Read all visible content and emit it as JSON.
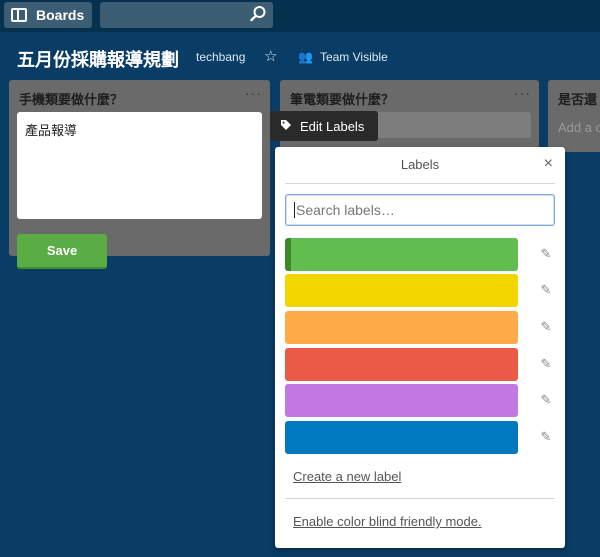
{
  "header": {
    "boards_label": "Boards",
    "search_placeholder": ""
  },
  "board": {
    "title": "五月份採購報導規劃",
    "team": "techbang",
    "visibility": "Team Visible"
  },
  "lists": [
    {
      "title": "手機類要做什麼？",
      "menu": "···",
      "card_text": "產品報導",
      "save_label": "Save"
    },
    {
      "title": "筆電類要做什麼？",
      "menu": "···"
    },
    {
      "title": "是否還",
      "add_card": "Add a c"
    }
  ],
  "tooltip": {
    "label": "Edit Labels"
  },
  "labels_popover": {
    "title": "Labels",
    "close": "×",
    "search_placeholder": "Search labels…",
    "labels": [
      {
        "color": "#61bd4f",
        "selected": true
      },
      {
        "color": "#f2d600",
        "selected": false
      },
      {
        "color": "#ffab4a",
        "selected": false
      },
      {
        "color": "#eb5a46",
        "selected": false
      },
      {
        "color": "#c377e0",
        "selected": false
      },
      {
        "color": "#0079bf",
        "selected": false
      }
    ],
    "create_label": "Create a new label",
    "colorblind_mode": "Enable color blind friendly mode."
  },
  "icons": {
    "boards": "boards-icon",
    "search": "search-icon",
    "star": "star-icon",
    "team": "people-icon",
    "tag": "tag-icon",
    "pencil": "pencil-icon",
    "close": "close-icon"
  }
}
